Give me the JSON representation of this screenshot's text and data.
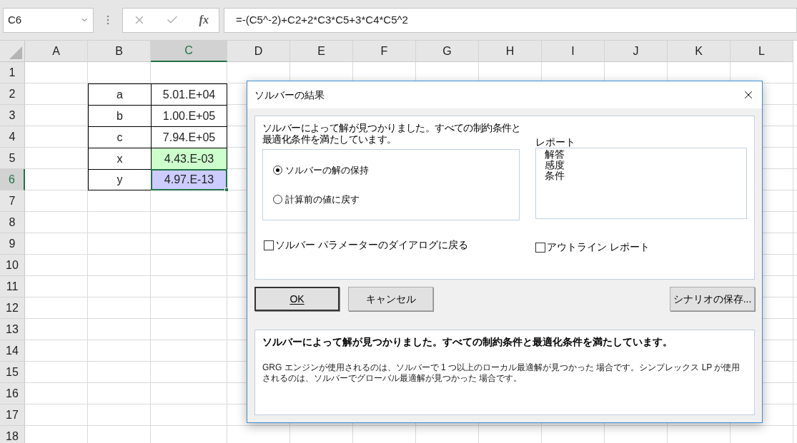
{
  "formula_bar": {
    "name_box": "C6",
    "function_label": "fx",
    "formula": "=-(C5^-2)+C2+2*C3*C5+3*C4*C5^2"
  },
  "sheet": {
    "columns": [
      {
        "label": "A",
        "selected": false
      },
      {
        "label": "B",
        "selected": false
      },
      {
        "label": "C",
        "selected": true
      },
      {
        "label": "D",
        "selected": false
      },
      {
        "label": "E",
        "selected": false
      },
      {
        "label": "F",
        "selected": false
      },
      {
        "label": "G",
        "selected": false
      },
      {
        "label": "H",
        "selected": false
      },
      {
        "label": "I",
        "selected": false
      },
      {
        "label": "J",
        "selected": false
      },
      {
        "label": "K",
        "selected": false
      },
      {
        "label": "L",
        "selected": false
      }
    ],
    "rows": [
      {
        "label": "1",
        "selected": false
      },
      {
        "label": "2",
        "selected": false
      },
      {
        "label": "3",
        "selected": false
      },
      {
        "label": "4",
        "selected": false
      },
      {
        "label": "5",
        "selected": false
      },
      {
        "label": "6",
        "selected": true
      },
      {
        "label": "7",
        "selected": false
      },
      {
        "label": "8",
        "selected": false
      },
      {
        "label": "9",
        "selected": false
      },
      {
        "label": "10",
        "selected": false
      },
      {
        "label": "11",
        "selected": false
      },
      {
        "label": "12",
        "selected": false
      },
      {
        "label": "13",
        "selected": false
      },
      {
        "label": "14",
        "selected": false
      },
      {
        "label": "15",
        "selected": false
      },
      {
        "label": "16",
        "selected": false
      },
      {
        "label": "17",
        "selected": false
      },
      {
        "label": "18",
        "selected": false
      }
    ],
    "table": [
      {
        "name": "a",
        "value": "5.01.E+04",
        "selected": false
      },
      {
        "name": "b",
        "value": "1.00.E+05",
        "selected": false
      },
      {
        "name": "c",
        "value": "7.94.E+05",
        "selected": false
      },
      {
        "name": "x",
        "value": "4.43.E-03",
        "selected": false,
        "color": "#ccffcc"
      },
      {
        "name": "y",
        "value": "4.97.E-13",
        "selected": true,
        "color": "#ccccff"
      }
    ]
  },
  "dialog": {
    "title": "ソルバーの結果",
    "message": "ソルバーによって解が見つかりました。すべての制約条件と最適化条件を満たしています。",
    "report_label": "レポート",
    "reports": [
      "解答",
      "感度",
      "条件"
    ],
    "options": [
      {
        "label": "ソルバーの解の保持",
        "selected": true
      },
      {
        "label": "計算前の値に戻す",
        "selected": false
      }
    ],
    "checkboxes": [
      {
        "label": "ソルバー パラメーターのダイアログに戻る",
        "checked": false
      },
      {
        "label": "アウトライン レポート",
        "checked": false
      }
    ],
    "buttons": [
      {
        "label": "OK",
        "default": true
      },
      {
        "label": "キャンセル",
        "default": false
      },
      {
        "label": "シナリオの保存...",
        "default": false
      }
    ],
    "footer": {
      "heading": "ソルバーによって解が見つかりました。すべての制約条件と最適化条件を満たしています。",
      "body": "GRG エンジンが使用されるのは、ソルバーで 1 つ以上のローカル最適解が見つかった 場合です。シンプレックス LP が使用されるのは、ソルバーでグローバル最適解が見つかった 場合です。"
    }
  }
}
